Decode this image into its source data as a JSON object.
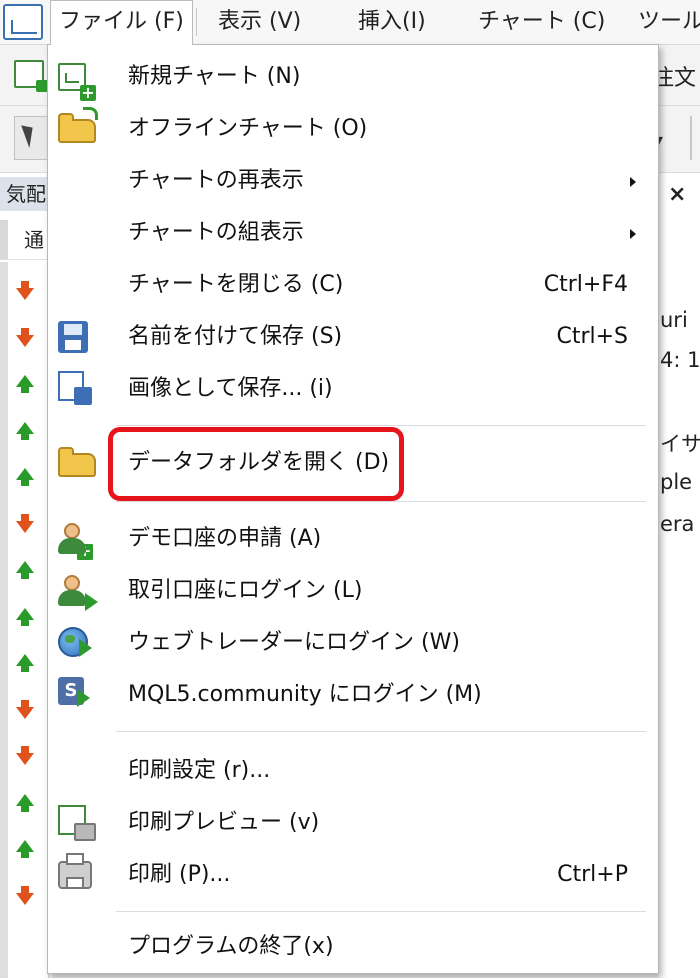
{
  "menubar": {
    "items": [
      {
        "label": "ファイル (F)"
      },
      {
        "label": "表示 (V)"
      },
      {
        "label": "挿入(I)"
      },
      {
        "label": "チャート (C)"
      },
      {
        "label": "ツール"
      }
    ]
  },
  "background": {
    "toolbar_right_text": "注文",
    "panel_title": "気配",
    "panel_column": "通",
    "right_fragments": [
      "uri",
      "4: 1",
      "イサ",
      "ple",
      "era"
    ],
    "arrows": [
      "down",
      "down",
      "up",
      "up",
      "up",
      "down",
      "up",
      "up",
      "up",
      "down",
      "down",
      "up",
      "up",
      "down"
    ]
  },
  "dropdown": {
    "items": [
      {
        "label": "新規チャート (N)",
        "shortcut": "",
        "icon": "new-chart-icon",
        "submenu": false
      },
      {
        "label": "オフラインチャート (O)",
        "shortcut": "",
        "icon": "open-folder-icon",
        "submenu": false
      },
      {
        "label": "チャートの再表示",
        "shortcut": "",
        "icon": "",
        "submenu": true
      },
      {
        "label": "チャートの組表示",
        "shortcut": "",
        "icon": "",
        "submenu": true
      },
      {
        "label": "チャートを閉じる (C)",
        "shortcut": "Ctrl+F4",
        "icon": "",
        "submenu": false
      },
      {
        "label": "名前を付けて保存 (S)",
        "shortcut": "Ctrl+S",
        "icon": "save-disk-icon",
        "submenu": false
      },
      {
        "label": "画像として保存... (i)",
        "shortcut": "",
        "icon": "save-image-icon",
        "submenu": false
      },
      {
        "label": "データフォルダを開く (D)",
        "shortcut": "",
        "icon": "folder-icon",
        "submenu": false
      },
      {
        "label": "デモ口座の申請 (A)",
        "shortcut": "",
        "icon": "user-add-icon",
        "submenu": false
      },
      {
        "label": "取引口座にログイン (L)",
        "shortcut": "",
        "icon": "user-login-icon",
        "submenu": false
      },
      {
        "label": "ウェブトレーダーにログイン (W)",
        "shortcut": "",
        "icon": "globe-icon",
        "submenu": false
      },
      {
        "label": "MQL5.community にログイン (M)",
        "shortcut": "",
        "icon": "mql5-icon",
        "submenu": false
      },
      {
        "label": "印刷設定 (r)...",
        "shortcut": "",
        "icon": "",
        "submenu": false
      },
      {
        "label": "印刷プレビュー (v)",
        "shortcut": "",
        "icon": "print-preview-icon",
        "submenu": false
      },
      {
        "label": "印刷 (P)...",
        "shortcut": "Ctrl+P",
        "icon": "printer-icon",
        "submenu": false
      },
      {
        "label": "プログラムの終了(x)",
        "shortcut": "",
        "icon": "",
        "submenu": false
      }
    ],
    "highlighted_item": "データフォルダを開く (D)",
    "highlight_color": "#e8141c"
  }
}
